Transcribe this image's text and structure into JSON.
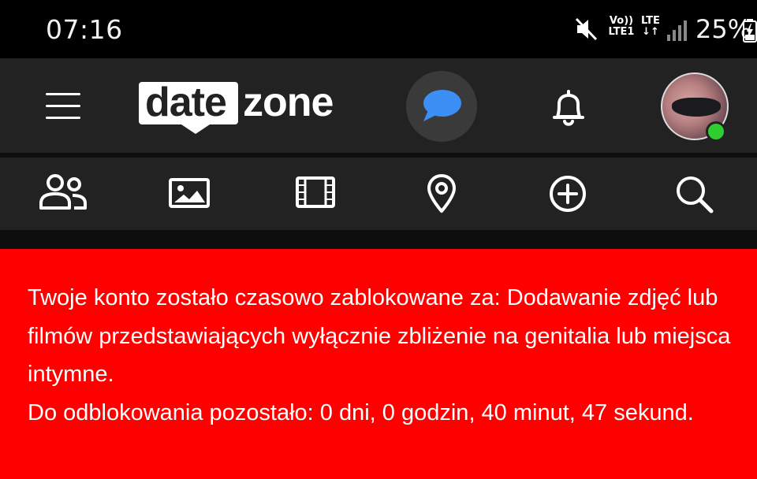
{
  "status_bar": {
    "time": "07:16",
    "volte_line1": "Vo))",
    "volte_line2": "LTE1",
    "lte_line1": "LTE",
    "lte_line2": "↓↑",
    "battery_percent": "25%",
    "icons": [
      "mute-icon",
      "signal-icon",
      "battery-charging-icon"
    ]
  },
  "header": {
    "logo_part1": "date",
    "logo_part2": "zone",
    "icons": [
      "menu-icon",
      "chat-icon",
      "bell-icon",
      "avatar"
    ],
    "online_status_color": "#2fcf2f"
  },
  "nav_icons": [
    "users-icon",
    "image-icon",
    "film-icon",
    "location-pin-icon",
    "add-circle-icon",
    "search-icon"
  ],
  "alert": {
    "background_color": "#fe0000",
    "message": "Twoje konto zostało czasowo zablokowane za: Dodawanie zdjęć lub filmów przedstawiających wyłącznie zbliżenie na genitalia lub miejsca intymne.",
    "countdown": "Do odblokowania pozostało: 0 dni, 0 godzin, 40 minut, 47 sekund."
  },
  "colors": {
    "header_bg": "#222222",
    "chat_accent": "#3b8ff5"
  }
}
